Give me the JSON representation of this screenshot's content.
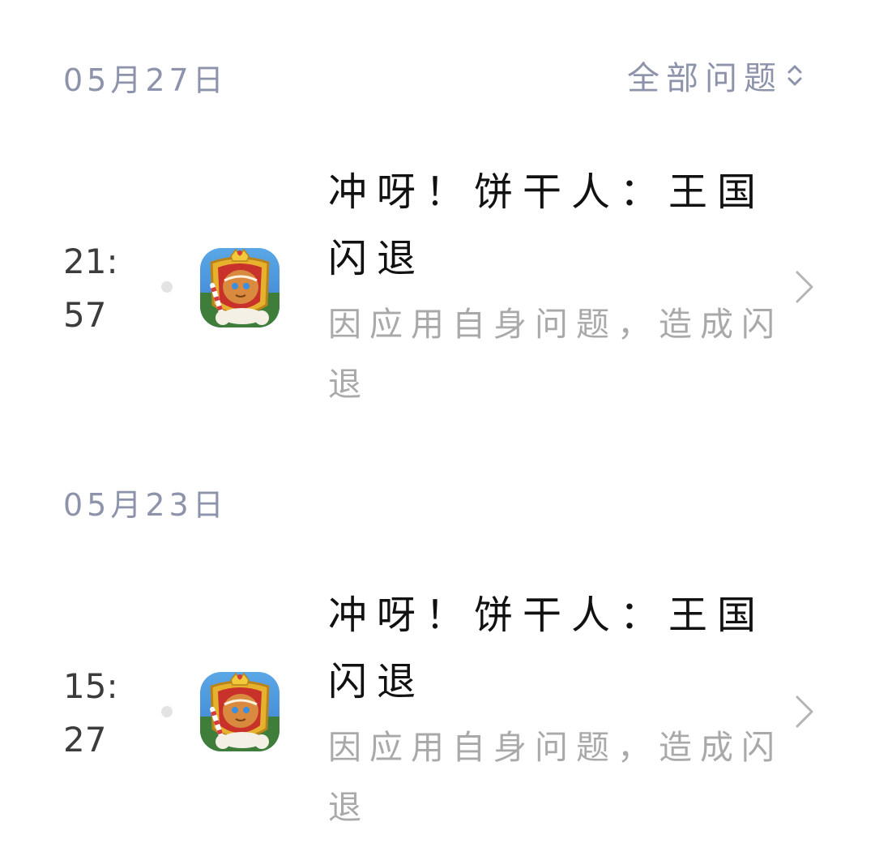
{
  "filter": {
    "label": "全部问题",
    "icon": "sort-chevrons-icon"
  },
  "groups": [
    {
      "date": "05月27日",
      "entries": [
        {
          "time": "21:\n57",
          "app_icon": "cookie-run-kingdom-app-icon",
          "title": "冲呀！饼干人：王国闪退",
          "description": "因应用自身问题，造成闪退",
          "chevron": "chevron-right-icon"
        }
      ]
    },
    {
      "date": "05月23日",
      "entries": [
        {
          "time": "15:\n27",
          "app_icon": "cookie-run-kingdom-app-icon",
          "title": "冲呀！饼干人：王国闪退",
          "description": "因应用自身问题，造成闪退",
          "chevron": "chevron-right-icon"
        }
      ]
    }
  ],
  "colors": {
    "header_text": "#8c93aa",
    "title_text": "#111111",
    "description_text": "#a9a9a9",
    "time_text": "#3c3c3c",
    "timeline_dot": "#e3e3e3"
  }
}
